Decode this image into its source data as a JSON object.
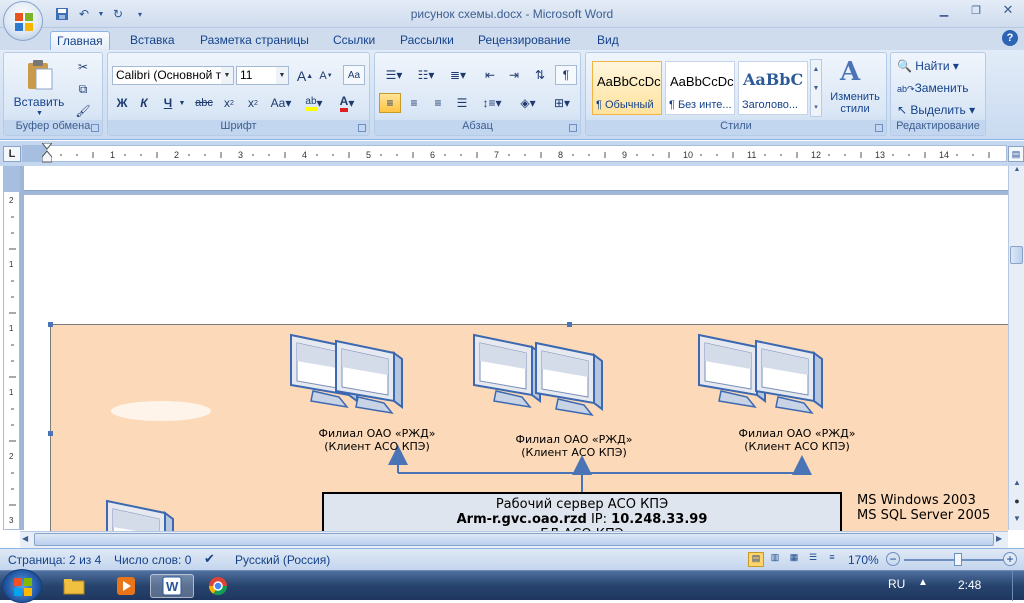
{
  "window": {
    "title": "рисунок схемы.docx - Microsoft Word",
    "minimize_icon": "minimize-icon",
    "maximize_icon": "restore-icon",
    "close_icon": "close-icon"
  },
  "tabs": [
    {
      "label": "Главная",
      "active": true
    },
    {
      "label": "Вставка"
    },
    {
      "label": "Разметка страницы"
    },
    {
      "label": "Ссылки"
    },
    {
      "label": "Рассылки"
    },
    {
      "label": "Рецензирование"
    },
    {
      "label": "Вид"
    }
  ],
  "ribbon": {
    "clipboard": {
      "label": "Буфер обмена",
      "paste": "Вставить"
    },
    "font": {
      "label": "Шрифт",
      "family": "Calibri (Основной те",
      "size": "11"
    },
    "paragraph": {
      "label": "Абзац"
    },
    "styles": {
      "label": "Стили",
      "items": [
        {
          "sample": "AaBbCcDc",
          "name": "¶ Обычный"
        },
        {
          "sample": "AaBbCcDc",
          "name": "¶ Без инте..."
        },
        {
          "sample": "AaBbC",
          "name": "Заголово..."
        }
      ],
      "change": "Изменить стили"
    },
    "editing": {
      "label": "Редактирование",
      "find": "Найти",
      "replace": "Заменить",
      "select": "Выделить"
    }
  },
  "diagram": {
    "client_label_1": "Филиал ОАО «РЖД»",
    "client_label_2": "(Клиент АСО КПЭ)",
    "server_line1": "Рабочий  сервер АСО КПЭ",
    "server_host": "Arm-r.gvc.oao.rzd",
    "server_ip_label": "IP:",
    "server_ip": "10.248.33.99",
    "server_line3": "БД АСО КПЭ",
    "os1": "MS Windows 2003",
    "os2": "MS SQL Server 2005",
    "colors": {
      "canvas": "#fcd9b8",
      "arrow": "#4a74b5"
    }
  },
  "status": {
    "page": "Страница: 2 из 4",
    "words": "Число слов: 0",
    "language": "Русский (Россия)",
    "zoom": "170%"
  },
  "taskbar": {
    "lang": "RU",
    "time": "2:48"
  }
}
